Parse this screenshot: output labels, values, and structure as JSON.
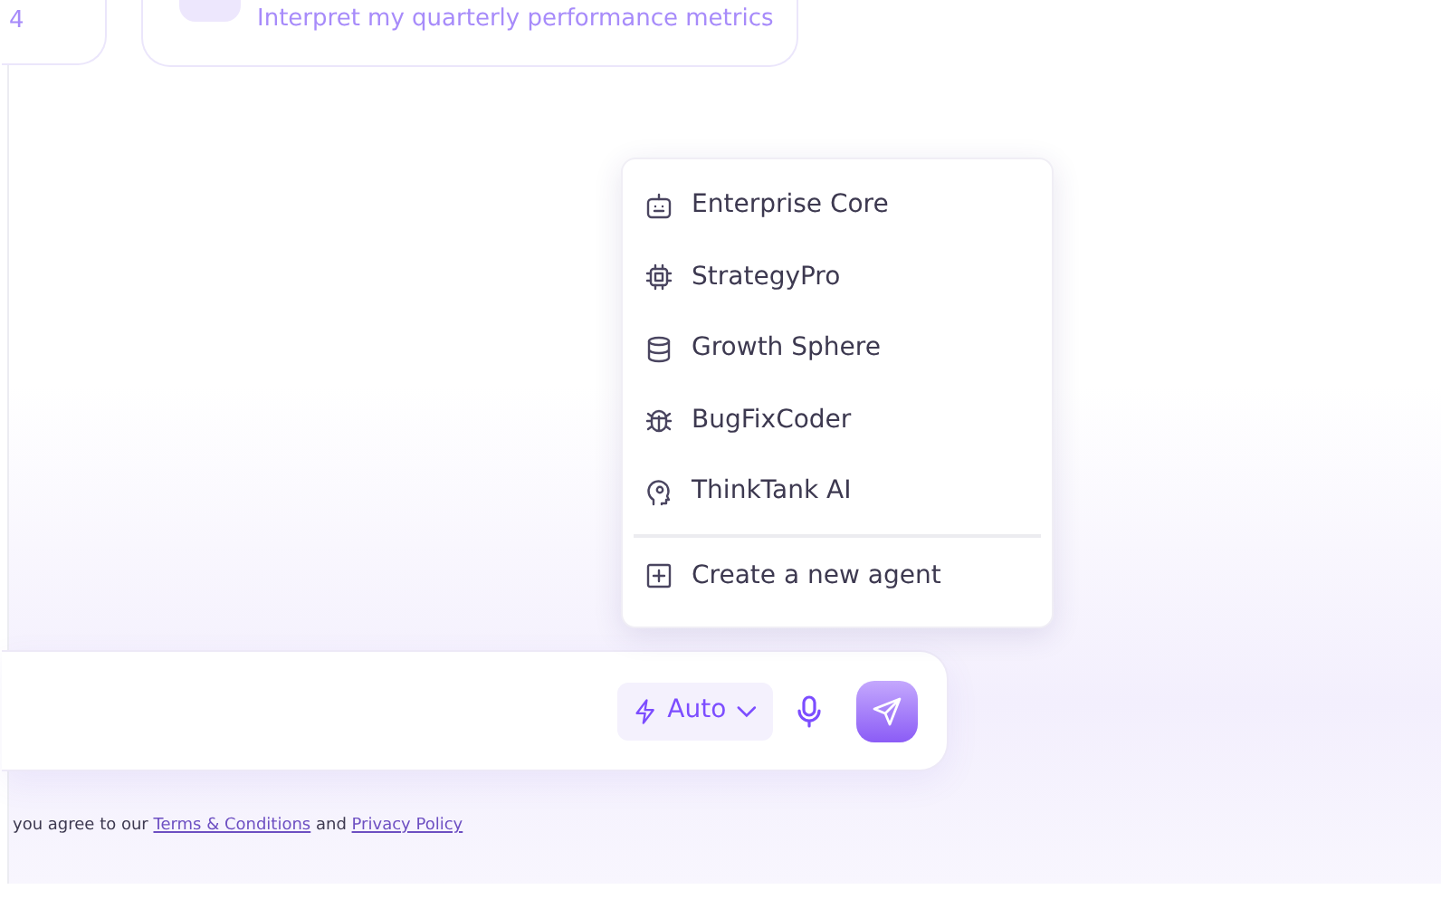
{
  "suggestion_cards": [
    {
      "text": "4"
    },
    {
      "text": "Interpret my quarterly performance metrics"
    }
  ],
  "agent_menu": {
    "items": [
      {
        "label": "Enterprise Core",
        "kind": "robot"
      },
      {
        "label": "StrategyPro",
        "kind": "chip"
      },
      {
        "label": "Growth Sphere",
        "kind": "database"
      },
      {
        "label": "BugFixCoder",
        "kind": "bug"
      },
      {
        "label": "ThinkTank AI",
        "kind": "head"
      }
    ],
    "create": {
      "label": "Create a new agent"
    }
  },
  "composer": {
    "mode": {
      "label": "Auto"
    }
  },
  "footer": {
    "before": "you agree to our",
    "terms": "Terms & Conditions",
    "middle": "and",
    "privacy": "Privacy Policy"
  }
}
